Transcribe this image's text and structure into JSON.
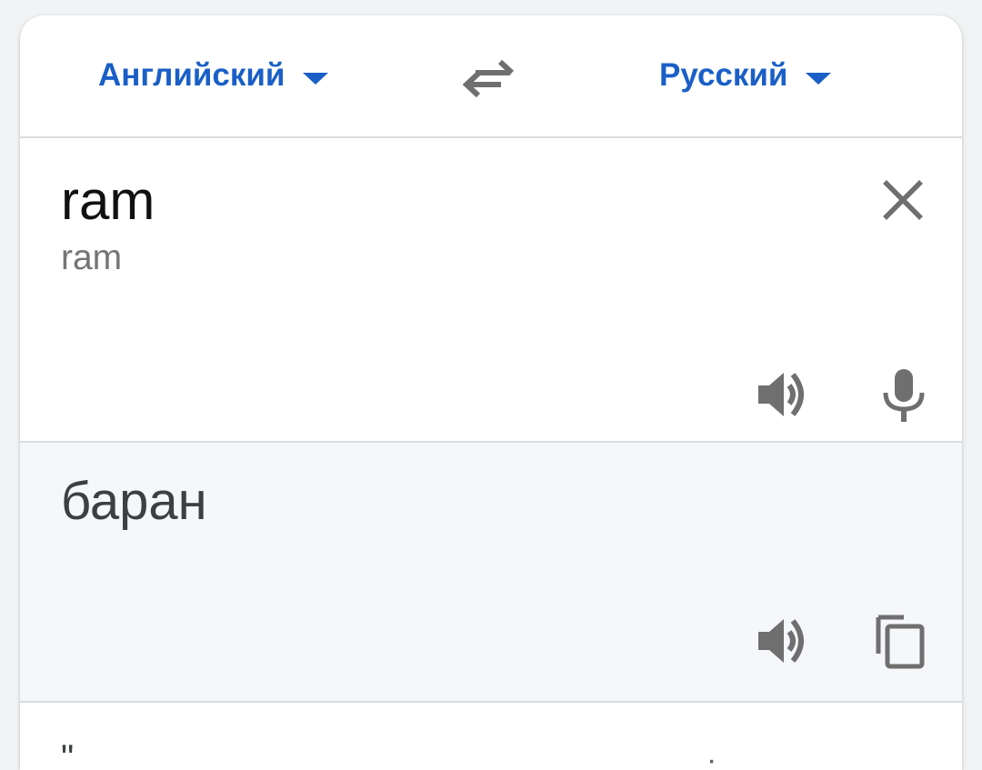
{
  "languages": {
    "source": "Английский",
    "target": "Русский"
  },
  "icons": {
    "swap": "swap-arrows-icon",
    "dropdown": "caret-down-icon",
    "clear": "close-icon",
    "speaker": "speaker-icon",
    "mic": "microphone-icon",
    "copy": "copy-icon"
  },
  "input": {
    "text": "ram",
    "transliteration": "ram"
  },
  "output": {
    "translation": "баран"
  },
  "footer": {
    "partial_left": "\"",
    "partial_right": "·"
  },
  "colors": {
    "accent": "#1a5fc7",
    "icon": "#6f6f6f",
    "output_bg": "#f5f7fa"
  }
}
